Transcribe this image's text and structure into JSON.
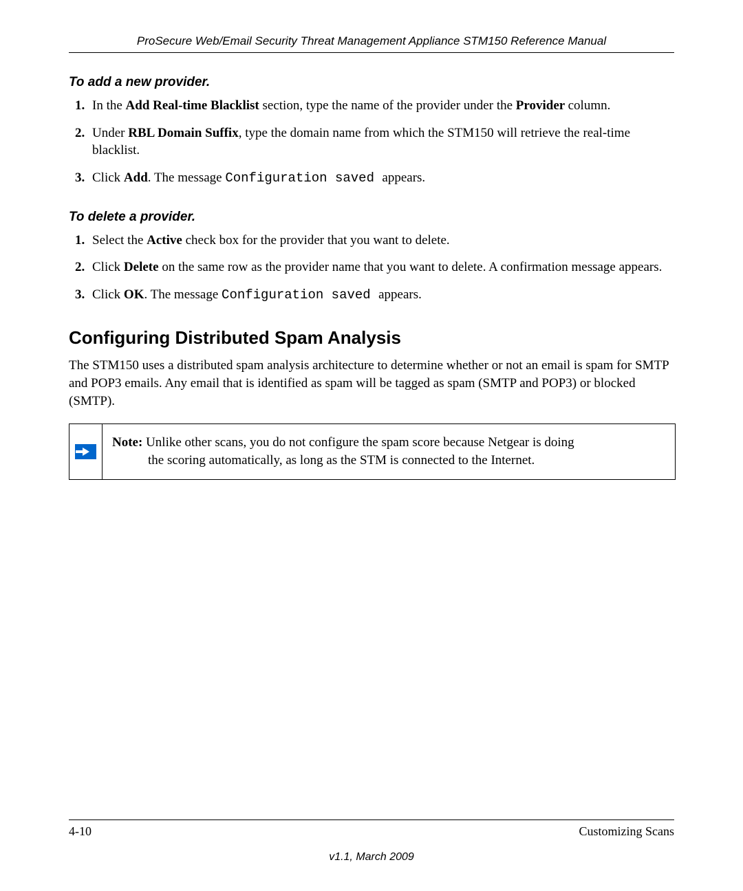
{
  "header": "ProSecure Web/Email Security Threat Management Appliance STM150 Reference Manual",
  "sections": {
    "add": {
      "heading": "To add a new provider.",
      "steps": [
        {
          "pre1": "In the ",
          "b1": "Add Real-time Blacklist ",
          "mid1": "section, type the name of the provider under the ",
          "b2": "Provider ",
          "post": "column."
        },
        {
          "pre1": "Under ",
          "b1": "RBL Domain Suffix",
          "mid1": ", type the domain name from which the STM150 will retrieve the real-time blacklist."
        },
        {
          "pre1": "Click ",
          "b1": "Add",
          "mid1": ". The message ",
          "mono": "Configuration saved ",
          "post": "appears."
        }
      ]
    },
    "delete": {
      "heading": "To delete a provider.",
      "steps": [
        {
          "pre1": "Select the ",
          "b1": "Active ",
          "mid1": "check box for the provider that you want to delete."
        },
        {
          "pre1": "Click ",
          "b1": "Delete ",
          "mid1": "on the same row as the provider name that you want to delete. A confirmation message appears."
        },
        {
          "pre1": "Click ",
          "b1": "OK",
          "mid1": ". The message ",
          "mono": "Configuration saved ",
          "post": "appears."
        }
      ]
    }
  },
  "title": "Configuring Distributed Spam Analysis",
  "body": "The STM150 uses a distributed spam analysis architecture to determine whether or not an email is spam for SMTP and POP3 emails. Any email that is identified as spam will be tagged as spam (SMTP and POP3) or blocked (SMTP).",
  "note": {
    "label": "Note: ",
    "line1": "Unlike other scans, you do not configure the spam score because Netgear is doing ",
    "line2": "the scoring automatically, as long as the STM is connected to the Internet."
  },
  "footer": {
    "page": "4-10",
    "section": "Customizing Scans",
    "version": "v1.1, March 2009"
  }
}
